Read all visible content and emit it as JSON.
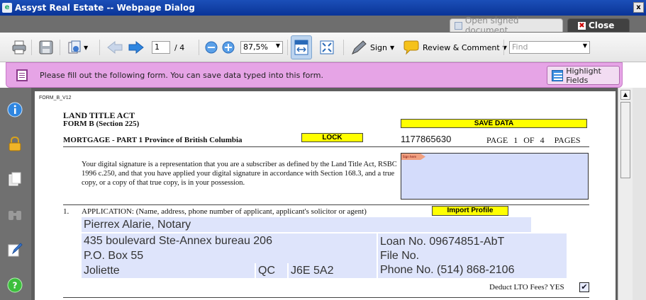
{
  "window": {
    "title": "Assyst Real Estate -- Webpage Dialog",
    "close_glyph": "x"
  },
  "tabs": {
    "open_signed": "Open signed document",
    "close": "Close"
  },
  "toolbar": {
    "page_current": "1",
    "page_total": "/ 4",
    "zoom": "87,5%",
    "sign_label": "Sign",
    "review_label": "Review & Comment",
    "find_placeholder": "Find"
  },
  "banner": {
    "message": "Please fill out the following form. You can save data typed into this form.",
    "highlight_label": "Highlight Fields"
  },
  "form": {
    "form_id": "FORM_B_V12",
    "act_title": "LAND TITLE ACT",
    "form_subtitle": "FORM B (Section 225)",
    "save_data": "SAVE DATA",
    "mortgage_line": "MORTGAGE - PART 1 Province of British Columbia",
    "lock": "LOCK",
    "doc_number": "1177865630",
    "page_word": "PAGE",
    "page_num": "1",
    "of_word": "OF",
    "total_pages": "4",
    "pages_word": "PAGES",
    "signature_text": "Your digital signature is a representation that you are a subscriber as defined by the Land Title Act, RSBC 1996 c.250, and that you have applied your digital signature in accordance with Section 168.3, and a true copy, or a copy of that true copy, is in your possession.",
    "sig_tag": "Sign here",
    "section_num": "1.",
    "application_label": "APPLICATION: (Name, address, phone number of applicant, applicant's solicitor or agent)",
    "import_profile": "Import Profile",
    "applicant_name": "Pierrex Alarie, Notary",
    "address_line1": "435 boulevard Ste-Annex bureau 206",
    "address_line2": "P.O. Box 55",
    "city": "Joliette",
    "province": "QC",
    "postal": "J6E 5A2",
    "loan_no": "Loan No. 09674851-AbT",
    "file_no": "File No.",
    "phone_no": "Phone No. (514) 868-2106",
    "deduct_label": "Deduct LTO Fees? YES",
    "deduct_checked": "✔"
  }
}
